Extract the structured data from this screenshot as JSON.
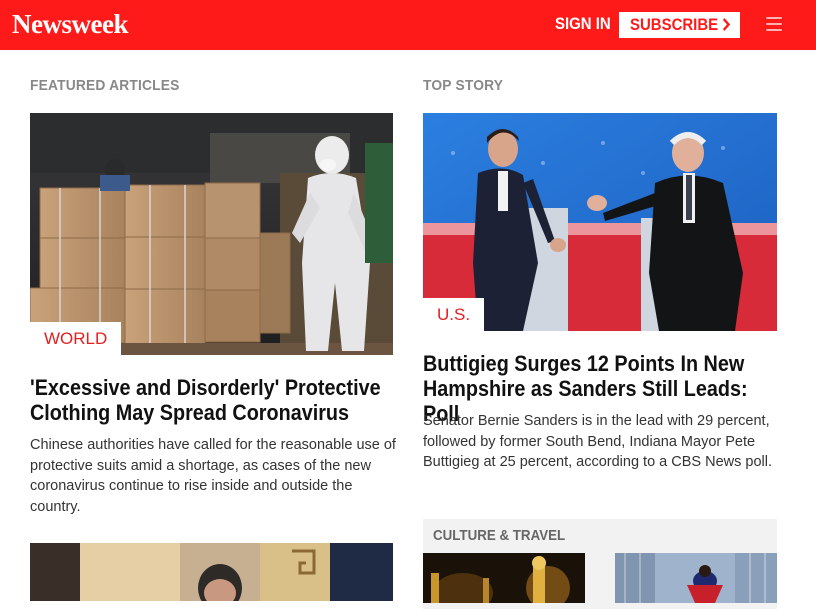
{
  "header": {
    "logo": "Newsweek",
    "signin_label": "SIGN IN",
    "subscribe_label": "SUBSCRIBE",
    "subscribe_chevron": "›",
    "brand_color": "#ff1a1a"
  },
  "featured": {
    "section_label": "FEATURED ARTICLES",
    "article": {
      "tag": "WORLD",
      "headline": "'Excessive and Disorderly' Protective Clothing May Spread Coronavirus",
      "summary": "Chinese authorities have called for the reasonable use of protective suits amid a shortage, as cases of the new coronavirus continue to rise inside and outside the country."
    }
  },
  "top_story": {
    "section_label": "TOP STORY",
    "article": {
      "tag": "U.S.",
      "headline": "Buttigieg Surges 12 Points In New Hampshire as Sanders Still Leads: Poll",
      "summary": "Senator Bernie Sanders is in the lead with 29 percent, followed by former South Bend, Indiana Mayor Pete Buttigieg at 25 percent, according to a CBS News poll."
    }
  },
  "culture": {
    "section_label": "CULTURE & TRAVEL"
  }
}
